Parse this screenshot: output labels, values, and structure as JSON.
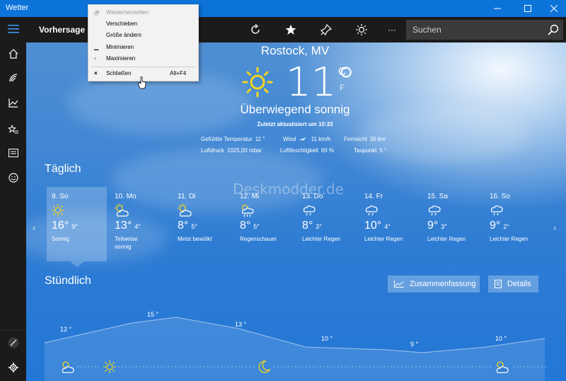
{
  "titlebar": {
    "app_title": "Wetter"
  },
  "header": {
    "title": "Vorhersage",
    "search_placeholder": "Suchen",
    "more_label": "···"
  },
  "current": {
    "city": "Rostock, MV",
    "temperature": "11°",
    "unit_c": "C",
    "unit_f": "F",
    "condition": "Überwiegend sonnig",
    "updated": "Zuletzt aktualisiert um 10:33",
    "details": {
      "feels_like_label": "Gefühlte Temperatur",
      "feels_like_value": "11 °",
      "wind_label": "Wind",
      "wind_value": "11 km/h",
      "visibility_label": "Fernsicht",
      "visibility_value": "35 km",
      "pressure_label": "Luftdruck",
      "pressure_value": "1025,00 mbar",
      "humidity_label": "Luftfeuchtigkeit",
      "humidity_value": "69 %",
      "dewpoint_label": "Taupunkt",
      "dewpoint_value": "5 °"
    }
  },
  "daily": {
    "title": "Täglich",
    "days": [
      {
        "name": "9. So",
        "icon": "sun-icon",
        "hi": "16°",
        "lo": "9°",
        "cond": "Sonnig"
      },
      {
        "name": "10. Mo",
        "icon": "partly-cloudy-icon",
        "hi": "13°",
        "lo": "4°",
        "cond": "Teilweise sonnig"
      },
      {
        "name": "11. Di",
        "icon": "partly-cloudy-icon",
        "hi": "8°",
        "lo": "5°",
        "cond": "Meist bewölkt"
      },
      {
        "name": "12. Mi",
        "icon": "showers-icon",
        "hi": "8°",
        "lo": "5°",
        "cond": "Regenschauer"
      },
      {
        "name": "13. Do",
        "icon": "light-rain-icon",
        "hi": "8°",
        "lo": "3°",
        "cond": "Leichter Regen"
      },
      {
        "name": "14. Fr",
        "icon": "light-rain-icon",
        "hi": "10°",
        "lo": "4°",
        "cond": "Leichter Regen"
      },
      {
        "name": "15. Sa",
        "icon": "light-rain-icon",
        "hi": "9°",
        "lo": "3°",
        "cond": "Leichter Regen"
      },
      {
        "name": "16. So",
        "icon": "light-rain-icon",
        "hi": "9°",
        "lo": "2°",
        "cond": "Leichter Regen"
      }
    ]
  },
  "hourly": {
    "title": "Stündlich",
    "summary_label": "Zusammenfassung",
    "details_label": "Details",
    "temps": [
      "12 °",
      "15 °",
      "13 °",
      "10 °",
      "9 °",
      "10 °"
    ],
    "icons": [
      "partly-cloudy-icon",
      "sun-icon",
      "moon-icon",
      "partly-cloudy-icon"
    ]
  },
  "context_menu": {
    "items": [
      {
        "label": "Wiederherstellen",
        "icon": "restore-icon",
        "shortcut": "",
        "disabled": true
      },
      {
        "label": "Verschieben",
        "icon": "",
        "shortcut": "",
        "disabled": false
      },
      {
        "label": "Größe ändern",
        "icon": "",
        "shortcut": "",
        "disabled": false
      },
      {
        "label": "Minimieren",
        "icon": "minimize-icon",
        "shortcut": "",
        "disabled": false
      },
      {
        "label": "Maximieren",
        "icon": "maximize-icon",
        "shortcut": "",
        "disabled": false
      },
      {
        "label": "Schließen",
        "icon": "close-icon",
        "shortcut": "Alt+F4",
        "disabled": false
      }
    ]
  },
  "watermark": "Deskmodder.de",
  "colors": {
    "titlebar": "#0c73d9",
    "rail": "#1b1b1b",
    "sun": "#f5d61c",
    "sky": "#2e7cd3"
  }
}
